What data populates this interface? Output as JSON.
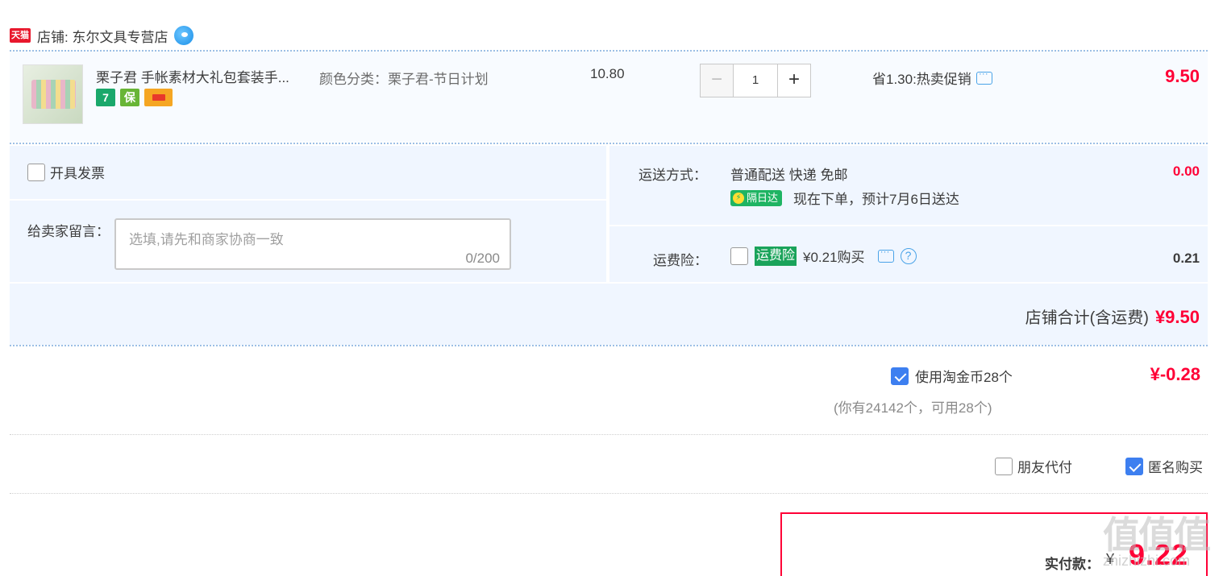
{
  "shop": {
    "logo_text": "天猫",
    "name": "店铺: 东尔文具专营店"
  },
  "item": {
    "title": "栗子君 手帐素材大礼包套装手...",
    "badges": [
      "7",
      "保"
    ],
    "sku": "颜色分类：栗子君-节日计划",
    "unit_price": "10.80",
    "quantity": "1",
    "minus": "−",
    "plus": "+",
    "promo": "省1.30:热卖促销",
    "total": "9.50"
  },
  "invoice": {
    "label": "开具发票",
    "checked": false
  },
  "message": {
    "label": "给卖家留言：",
    "placeholder": "选填,请先和商家协商一致",
    "count": "0/200"
  },
  "shipping": {
    "label": "运送方式：",
    "method": "普通配送 快递 免邮",
    "fee": "0.00",
    "next_day_badge": "隔日达",
    "next_day_text": "现在下单，预计7月6日送达"
  },
  "insurance": {
    "label": "运费险：",
    "badge": "运费险",
    "text": "¥0.21购买",
    "fee": "0.21"
  },
  "store_total": {
    "label": "店铺合计(含运费)",
    "amount": "¥9.50"
  },
  "coins": {
    "label": "使用淘金币28个",
    "amount": "¥-0.28",
    "note": "(你有24142个，可用28个)",
    "checked": true
  },
  "options": {
    "friend_pay": "朋友代付",
    "anonymous": "匿名购买"
  },
  "payment": {
    "label": "实付款：",
    "currency": "¥",
    "amount": "9.22"
  },
  "watermark": {
    "big": "值值值",
    "small": "zhizhizhi.com"
  },
  "colors": {
    "accent_red": "#ff0036",
    "panel_blue": "#f0f6ff",
    "check_blue": "#3d7ff0",
    "badge_green": "#1aa35a"
  }
}
